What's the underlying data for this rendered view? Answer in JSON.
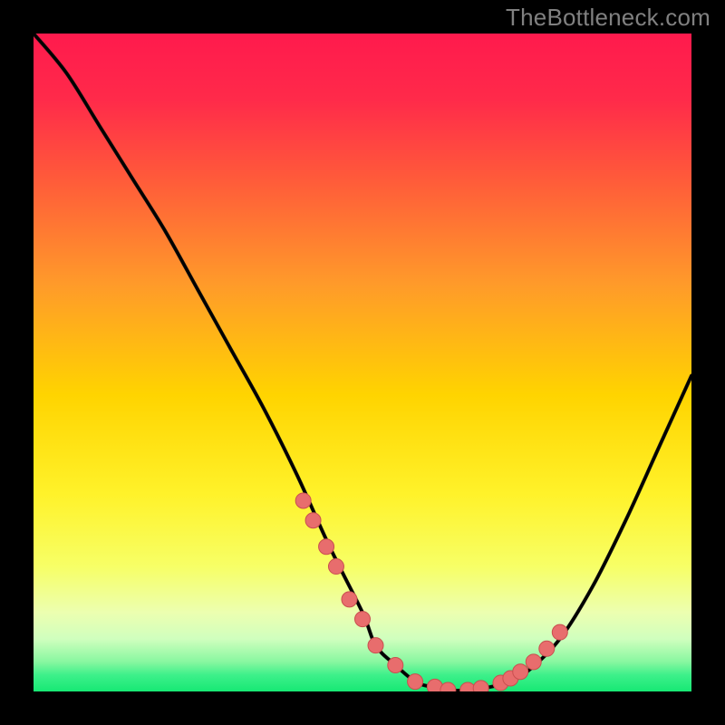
{
  "watermark": "TheBottleneck.com",
  "colors": {
    "background": "#000000",
    "gradient_top": "#ff1a4d",
    "gradient_upper_mid": "#ff6633",
    "gradient_mid": "#ffd400",
    "gradient_lower_mid": "#f5ff5c",
    "gradient_band_pale": "#ecffc0",
    "gradient_bottom": "#17e874",
    "curve": "#000000",
    "curve_dark": "#111111",
    "dot_fill": "#e86d6d",
    "dot_stroke": "#c94f4f"
  },
  "chart_data": {
    "type": "line",
    "title": "",
    "xlabel": "",
    "ylabel": "",
    "xlim": [
      0,
      100
    ],
    "ylim": [
      0,
      100
    ],
    "series": [
      {
        "name": "bottleneck-curve",
        "x": [
          0,
          5,
          10,
          15,
          20,
          25,
          30,
          35,
          40,
          45,
          50,
          52,
          55,
          58,
          60,
          63,
          66,
          70,
          72,
          75,
          80,
          85,
          90,
          95,
          100
        ],
        "y": [
          100,
          94,
          86,
          78,
          70,
          61,
          52,
          43,
          33,
          22,
          12,
          7,
          4,
          1.5,
          0.8,
          0.2,
          0.2,
          0.8,
          1.5,
          3,
          8,
          16,
          26,
          37,
          48
        ]
      }
    ],
    "highlighted_points": {
      "name": "dots",
      "x": [
        41,
        42.5,
        44.5,
        46,
        48,
        50,
        52,
        55,
        58,
        61,
        63,
        66,
        68,
        71,
        72.5,
        74,
        76,
        78,
        80
      ],
      "y": [
        29,
        26,
        22,
        19,
        14,
        11,
        7,
        4,
        1.5,
        0.7,
        0.2,
        0.2,
        0.5,
        1.3,
        2,
        3,
        4.5,
        6.5,
        9
      ]
    }
  }
}
